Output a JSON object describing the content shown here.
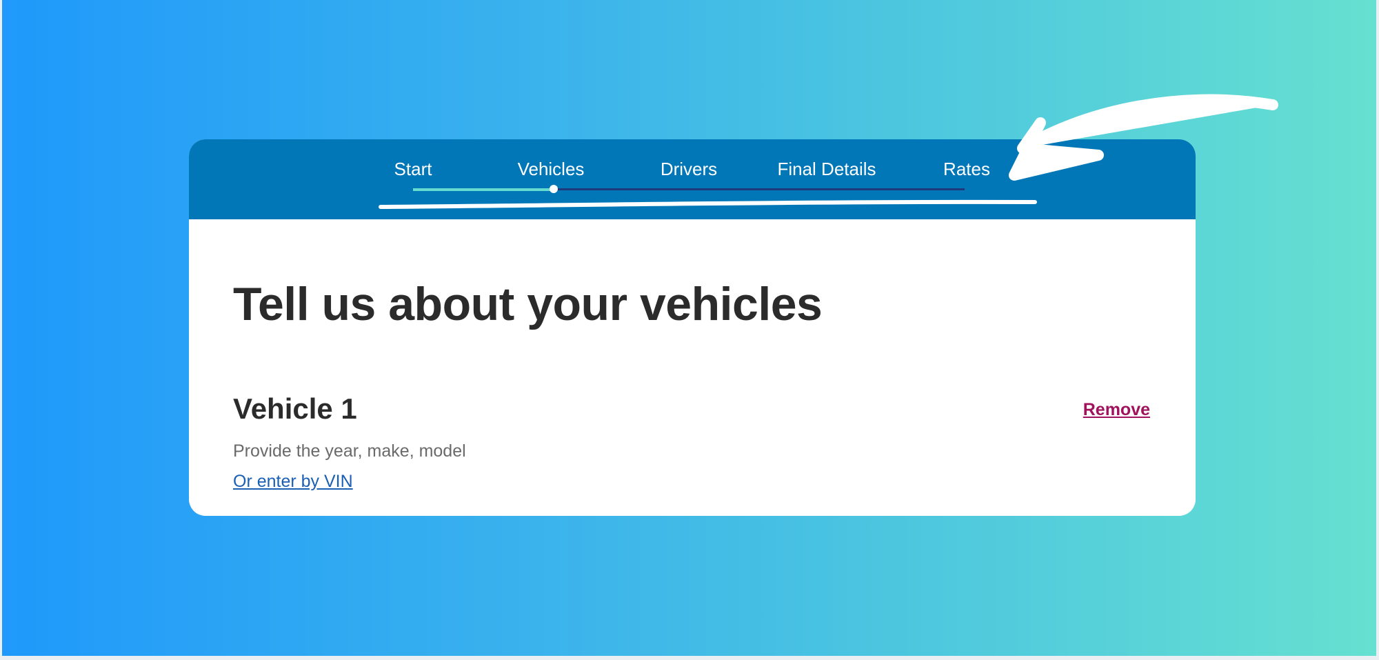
{
  "stepper": {
    "steps": [
      {
        "label": "Start"
      },
      {
        "label": "Vehicles"
      },
      {
        "label": "Drivers"
      },
      {
        "label": "Final Details"
      },
      {
        "label": "Rates"
      }
    ],
    "current_step": "Vehicles",
    "progress_percent": 25
  },
  "page": {
    "title": "Tell us about your vehicles"
  },
  "vehicle": {
    "heading": "Vehicle 1",
    "remove_label": "Remove",
    "instruction": "Provide the year, make, model",
    "vin_link": "Or enter by VIN"
  },
  "colors": {
    "header_blue": "#0277b7",
    "progress_teal": "#64dccf",
    "remove_magenta": "#a0135c",
    "link_blue": "#1a5fb4",
    "background_gradient_start": "#1f99fb",
    "background_gradient_end": "#66e0d0"
  },
  "icons": {
    "annotation": "curved-arrow-icon"
  }
}
